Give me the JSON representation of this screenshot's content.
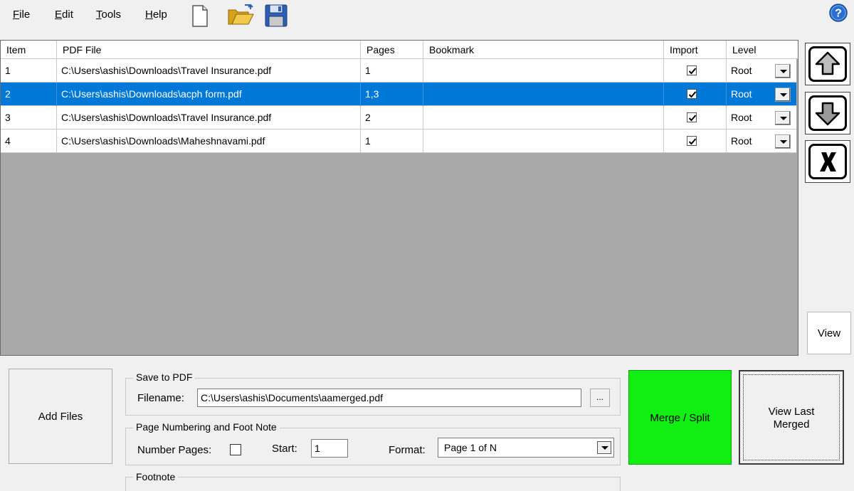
{
  "menu": {
    "file": {
      "accel": "F",
      "rest": "ile"
    },
    "edit": {
      "accel": "E",
      "rest": "dit"
    },
    "tools": {
      "accel": "T",
      "rest": "ools"
    },
    "help": {
      "accel": "H",
      "rest": "elp"
    }
  },
  "toolbar": {
    "icons": [
      "new-document-icon",
      "open-folder-icon",
      "save-disk-icon"
    ],
    "help_icon": "help-icon"
  },
  "grid": {
    "columns": {
      "item": "Item",
      "pdf_file": "PDF File",
      "pages": "Pages",
      "bookmark": "Bookmark",
      "import": "Import",
      "level": "Level"
    },
    "rows": [
      {
        "item": "1",
        "pdf_file": "C:\\Users\\ashis\\Downloads\\Travel Insurance.pdf",
        "pages": "1",
        "bookmark": "",
        "import": true,
        "level": "Root",
        "selected": false
      },
      {
        "item": "2",
        "pdf_file": "C:\\Users\\ashis\\Downloads\\acph form.pdf",
        "pages": "1,3",
        "bookmark": "",
        "import": true,
        "level": "Root",
        "selected": true
      },
      {
        "item": "3",
        "pdf_file": "C:\\Users\\ashis\\Downloads\\Travel Insurance.pdf",
        "pages": "2",
        "bookmark": "",
        "import": true,
        "level": "Root",
        "selected": false
      },
      {
        "item": "4",
        "pdf_file": "C:\\Users\\ashis\\Downloads\\Maheshnavami.pdf",
        "pages": "1",
        "bookmark": "",
        "import": true,
        "level": "Root",
        "selected": false
      }
    ]
  },
  "side": {
    "move_up_icon": "arrow-up-icon",
    "move_down_icon": "arrow-down-icon",
    "remove_icon": "x-remove-icon",
    "view_label": "View"
  },
  "bottom": {
    "add_files_label": "Add Files",
    "save_group_title": "Save to PDF",
    "filename_label": "Filename:",
    "filename_value": "C:\\Users\\ashis\\Documents\\aamerged.pdf",
    "browse_label": "...",
    "numbering_group_title": "Page Numbering and Foot Note",
    "number_pages_label": "Number Pages:",
    "number_pages_checked": false,
    "start_label": "Start:",
    "start_value": "1",
    "format_label": "Format:",
    "format_value": "Page 1 of N",
    "footnote_group_title": "Footnote",
    "merge_label": "Merge / Split",
    "view_last_line1": "View Last",
    "view_last_line2": "Merged"
  },
  "colors": {
    "selection": "#0078d7",
    "merge_button": "#11ee11",
    "grid_background": "#a9a9a9"
  }
}
